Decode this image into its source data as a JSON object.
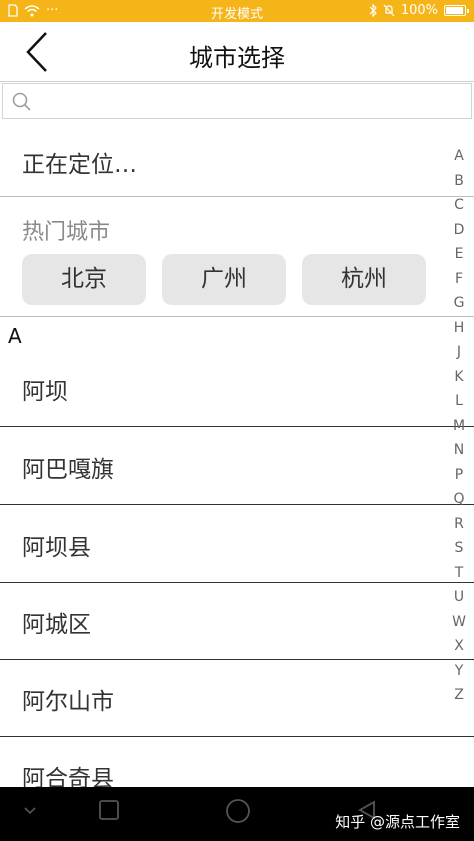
{
  "status_bar": {
    "mode_text": "开发模式",
    "battery_text": "100%",
    "battery_level": 1.0,
    "background": "#f5b418"
  },
  "header": {
    "title": "城市选择",
    "back_icon": "chevron-left-icon"
  },
  "search": {
    "icon": "search-icon",
    "value": "",
    "placeholder": ""
  },
  "locating": {
    "text": "正在定位…"
  },
  "hot_cities": {
    "title": "热门城市",
    "cities": [
      "北京",
      "广州",
      "杭州"
    ]
  },
  "city_list": {
    "group_letter": "A",
    "cities": [
      "阿坝",
      "阿巴嘎旗",
      "阿坝县",
      "阿城区",
      "阿尔山市",
      "阿合奇县"
    ]
  },
  "alphabet_index": [
    "A",
    "B",
    "C",
    "D",
    "E",
    "F",
    "G",
    "H",
    "J",
    "K",
    "L",
    "M",
    "N",
    "P",
    "Q",
    "R",
    "S",
    "T",
    "U",
    "W",
    "X",
    "Y",
    "Z"
  ],
  "nav_bar": {
    "watermark": "知乎 @源点工作室"
  }
}
